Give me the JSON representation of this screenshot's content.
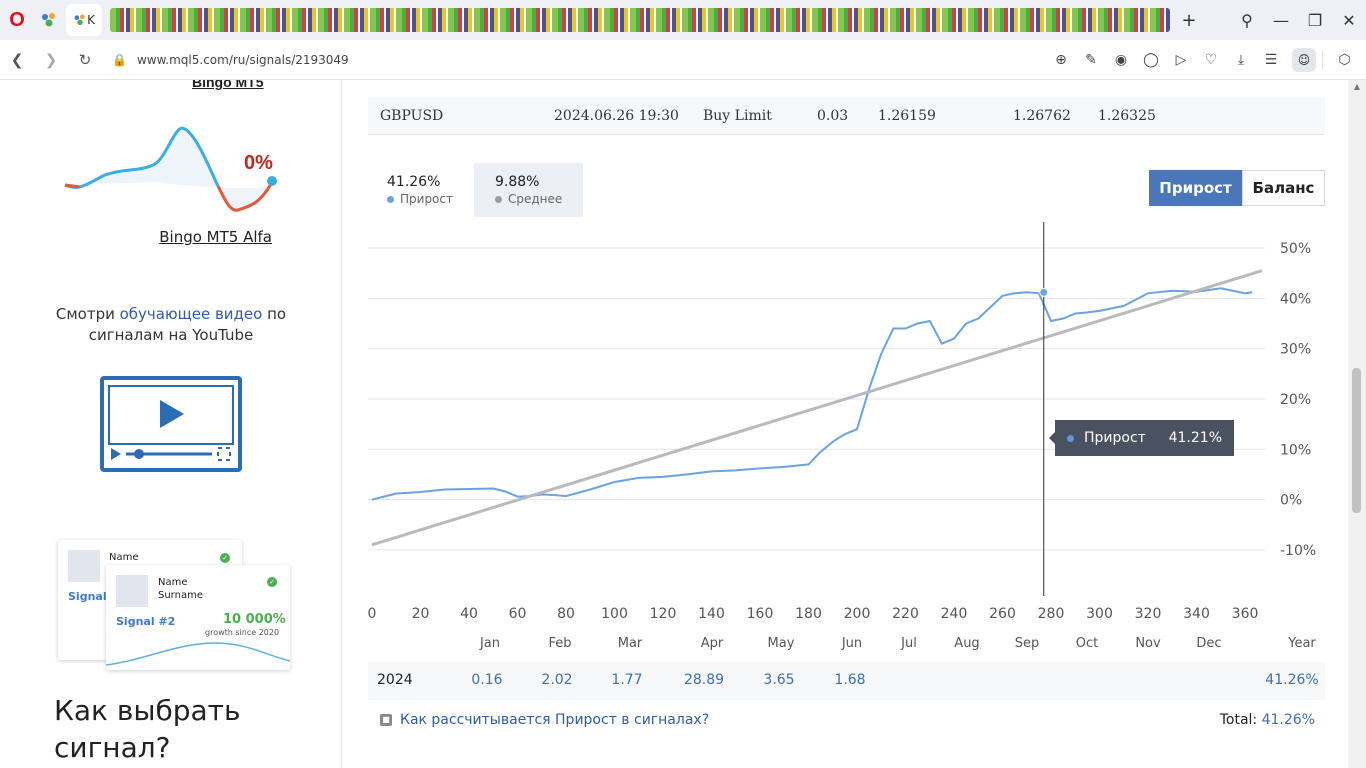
{
  "browser": {
    "logo": "O",
    "active_tab_label": "K",
    "url": "www.mql5.com/ru/signals/2193049",
    "new_tab": "+"
  },
  "sidebar": {
    "top_signal_link": "Bingo MT5",
    "sparkline_value": "0%",
    "signal_name": "Bingo MT5 Alfa",
    "promo_text_1": "Смотри ",
    "promo_link": "обучающее видео",
    "promo_text_2": " по сигналам на YouTube",
    "card1": {
      "name": "Name",
      "signal": "Signal #"
    },
    "card2": {
      "name": "Name",
      "surname": "Surname",
      "signal": "Signal #2",
      "growth": "10 000%",
      "since": "growth since 2020"
    },
    "how_to_choose": "Как выбрать сигнал?"
  },
  "order": {
    "symbol": "GBPUSD",
    "time": "2024.06.26 19:30",
    "type": "Buy Limit",
    "volume": "0.03",
    "price": "1.26159",
    "sl": "1.26762",
    "tp": "1.26325"
  },
  "stats": {
    "growth_value": "41.26%",
    "growth_label": "Прирост",
    "average_value": "9.88%",
    "average_label": "Среднее"
  },
  "toggle": {
    "growth": "Прирост",
    "balance": "Баланс"
  },
  "tooltip": {
    "label": "Прирост",
    "value": "41.21%"
  },
  "chart_data": {
    "type": "line",
    "x_ticks": [
      0,
      20,
      40,
      60,
      80,
      100,
      120,
      140,
      160,
      180,
      200,
      220,
      240,
      260,
      280,
      300,
      320,
      340,
      360
    ],
    "y_ticks": [
      "50%",
      "40%",
      "30%",
      "20%",
      "10%",
      "0%",
      "-10%"
    ],
    "xlim": [
      0,
      367
    ],
    "ylim": [
      -14,
      52
    ],
    "series": [
      {
        "name": "Прирост",
        "color": "#6aa3e0",
        "x": [
          0,
          10,
          20,
          30,
          40,
          50,
          55,
          60,
          65,
          70,
          75,
          80,
          90,
          100,
          110,
          120,
          130,
          140,
          150,
          160,
          170,
          180,
          185,
          190,
          195,
          200,
          205,
          210,
          215,
          220,
          225,
          230,
          235,
          240,
          245,
          250,
          260,
          265,
          270,
          275,
          280,
          285,
          290,
          295,
          300,
          310,
          320,
          330,
          340,
          350,
          360,
          363
        ],
        "y": [
          0,
          1.2,
          1.5,
          2.0,
          2.1,
          2.2,
          1.6,
          0.6,
          0.7,
          1.0,
          0.9,
          0.7,
          2.0,
          3.5,
          4.3,
          4.5,
          5.0,
          5.6,
          5.8,
          6.2,
          6.5,
          7.0,
          9.5,
          11.5,
          13.0,
          14.0,
          22.0,
          29.0,
          34.0,
          34.0,
          35.0,
          35.5,
          31.0,
          32.0,
          35.0,
          36.0,
          40.5,
          41.0,
          41.2,
          41.0,
          35.5,
          36.0,
          37.0,
          37.2,
          37.5,
          38.5,
          41.0,
          41.5,
          41.3,
          42.0,
          41.0,
          41.2
        ]
      },
      {
        "name": "Среднее",
        "color": "#b8babf",
        "x": [
          0,
          367
        ],
        "y": [
          -9,
          45.5
        ]
      }
    ],
    "crosshair_x": 277
  },
  "months": [
    "Jan",
    "Feb",
    "Mar",
    "Apr",
    "May",
    "Jun",
    "Jul",
    "Aug",
    "Sep",
    "Oct",
    "Nov",
    "Dec",
    "Year"
  ],
  "year_row": {
    "year": "2024",
    "values": [
      "0.16",
      "2.02",
      "1.77",
      "28.89",
      "3.65",
      "1.68"
    ],
    "total": "41.26%"
  },
  "help_link": "Как рассчитывается Прирост в сигналах?",
  "total_label": "Total:",
  "total_value": "41.26%"
}
